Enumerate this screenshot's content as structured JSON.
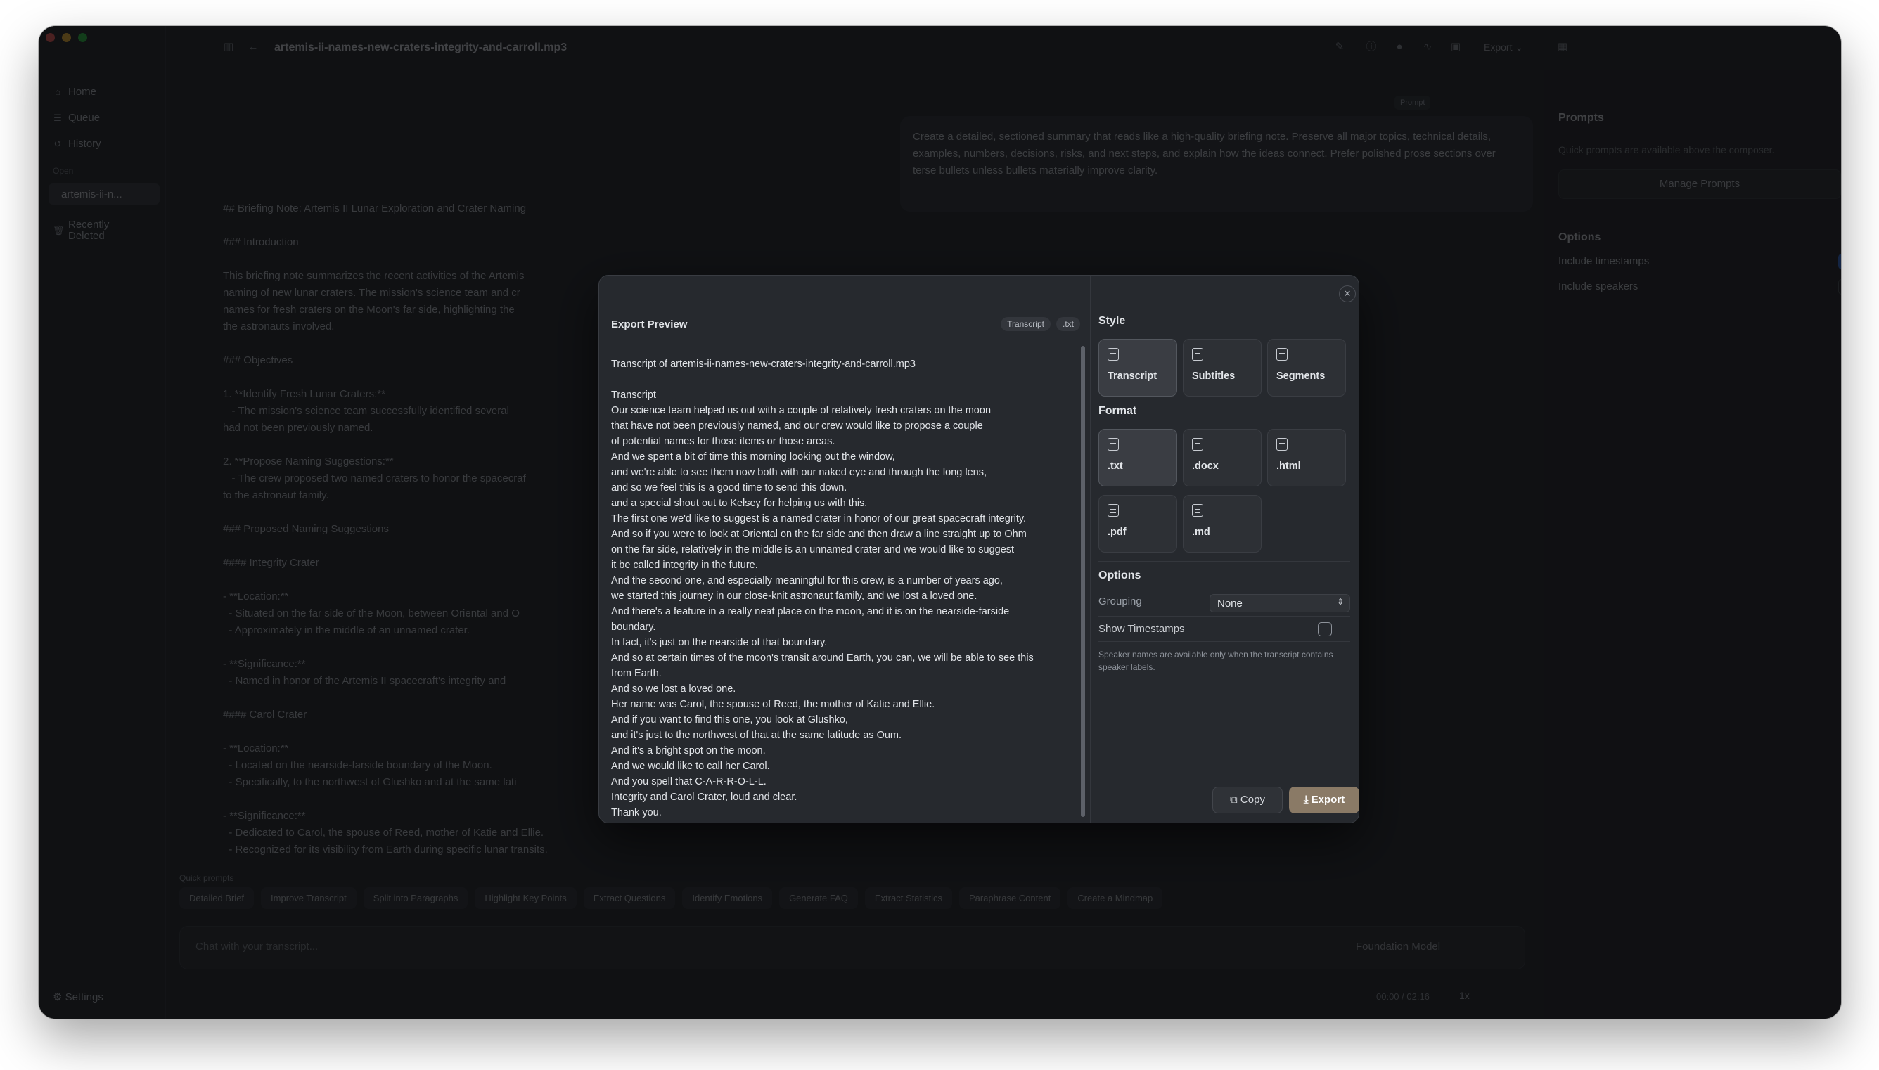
{
  "app": {
    "file_title": "artemis-ii-names-new-craters-integrity-and-carroll.mp3",
    "export_menu": "Export ⌄"
  },
  "sidebar": {
    "items": [
      {
        "label": "Home",
        "icon": "home-icon"
      },
      {
        "label": "Queue",
        "icon": "queue-icon"
      },
      {
        "label": "History",
        "icon": "history-icon"
      }
    ],
    "open_label": "Open",
    "active_file": "artemis-ii-n...",
    "recently_deleted": "Recently\nDeleted",
    "settings": "Settings"
  },
  "chat": {
    "prompt_chip": "Prompt",
    "prompt_text": "Create a detailed, sectioned summary that reads like a high-quality briefing note. Preserve all major topics, technical details, examples, numbers, decisions, risks, and next steps, and explain how the ideas connect. Prefer polished prose sections over terse bullets unless bullets materially improve clarity.",
    "response_lines": [
      "## Briefing Note: Artemis II Lunar Exploration and Crater Naming",
      "",
      "### Introduction",
      "",
      "This briefing note summarizes the recent activities of the Artemis",
      "naming of new lunar craters. The mission's science team and cr",
      "names for fresh craters on the Moon's far side, highlighting the",
      "the astronauts involved.",
      "",
      "### Objectives",
      "",
      "1. **Identify Fresh Lunar Craters:**",
      "   - The mission's science team successfully identified several",
      "had not been previously named.",
      "",
      "2. **Propose Naming Suggestions:**",
      "   - The crew proposed two named craters to honor the spacecraf",
      "to the astronaut family.",
      "",
      "### Proposed Naming Suggestions",
      "",
      "#### Integrity Crater",
      "",
      "- **Location:**",
      "  - Situated on the far side of the Moon, between Oriental and O",
      "  - Approximately in the middle of an unnamed crater.",
      "",
      "- **Significance:**",
      "  - Named in honor of the Artemis II spacecraft's integrity and",
      "",
      "#### Carol Crater",
      "",
      "- **Location:**",
      "  - Located on the nearside-farside boundary of the Moon.",
      "  - Specifically, to the northwest of Glushko and at the same lati",
      "",
      "- **Significance:**",
      "  - Dedicated to Carol, the spouse of Reed, mother of Katie and Ellie.",
      "  - Recognized for its visibility from Earth during specific lunar transits."
    ],
    "quick_prompts_label": "Quick prompts",
    "quick_prompts": [
      "Detailed Brief",
      "Improve Transcript",
      "Split into Paragraphs",
      "Highlight Key Points",
      "Extract Questions",
      "Identify Emotions",
      "Generate FAQ",
      "Extract Statistics",
      "Paraphrase Content",
      "Create a Mindmap"
    ],
    "composer_placeholder": "Chat with your transcript...",
    "model": "Foundation Model"
  },
  "player": {
    "time": "00:00 / 02:16",
    "speed": "1x"
  },
  "right_panel": {
    "prompts_title": "Prompts",
    "prompts_sub": "Quick prompts are available above the composer.",
    "manage_button": "Manage Prompts",
    "options_title": "Options",
    "include_timestamps": "Include timestamps",
    "include_timestamps_checked": true,
    "include_speakers": "Include speakers",
    "include_speakers_checked": false
  },
  "export_dialog": {
    "title": "Export Preview",
    "tags": [
      "Transcript",
      ".txt"
    ],
    "preview_text": "Transcript of artemis-ii-names-new-craters-integrity-and-carroll.mp3\n\nTranscript\nOur science team helped us out with a couple of relatively fresh craters on the moon\nthat have not been previously named, and our crew would like to propose a couple\nof potential names for those items or those areas.\nAnd we spent a bit of time this morning looking out the window,\nand we're able to see them now both with our naked eye and through the long lens,\nand so we feel this is a good time to send this down.\nand a special shout out to Kelsey for helping us with this.\nThe first one we'd like to suggest is a named crater in honor of our great spacecraft integrity.\nAnd so if you were to look at Oriental on the far side and then draw a line straight up to Ohm\non the far side, relatively in the middle is an unnamed crater and we would like to suggest\nit be called integrity in the future.\nAnd the second one, and especially meaningful for this crew, is a number of years ago,\nwe started this journey in our close-knit astronaut family, and we lost a loved one.\nAnd there's a feature in a really neat place on the moon, and it is on the nearside-farside\nboundary.\nIn fact, it's just on the nearside of that boundary.\nAnd so at certain times of the moon's transit around Earth, you can, we will be able to see this\nfrom Earth.\nAnd so we lost a loved one.\nHer name was Carol, the spouse of Reed, the mother of Katie and Ellie.\nAnd if you want to find this one, you look at Glushko,\nand it's just to the northwest of that at the same latitude as Oum.\nAnd it's a bright spot on the moon.\nAnd we would like to call her Carol.\nAnd you spell that C-A-R-R-O-L-L.\nIntegrity and Carol Crater, loud and clear.\nThank you.",
    "style_label": "Style",
    "styles": [
      {
        "label": "Transcript",
        "selected": true
      },
      {
        "label": "Subtitles",
        "selected": false
      },
      {
        "label": "Segments",
        "selected": false
      }
    ],
    "format_label": "Format",
    "formats": [
      {
        "label": ".txt",
        "selected": true
      },
      {
        "label": ".docx",
        "selected": false
      },
      {
        "label": ".html",
        "selected": false
      },
      {
        "label": ".pdf",
        "selected": false
      },
      {
        "label": ".md",
        "selected": false
      }
    ],
    "options_label": "Options",
    "grouping_label": "Grouping",
    "grouping_value": "None",
    "show_timestamps_label": "Show Timestamps",
    "show_timestamps_checked": false,
    "speaker_note": "Speaker names are available only when the transcript contains speaker labels.",
    "copy_button": "Copy",
    "export_button": "Export"
  }
}
